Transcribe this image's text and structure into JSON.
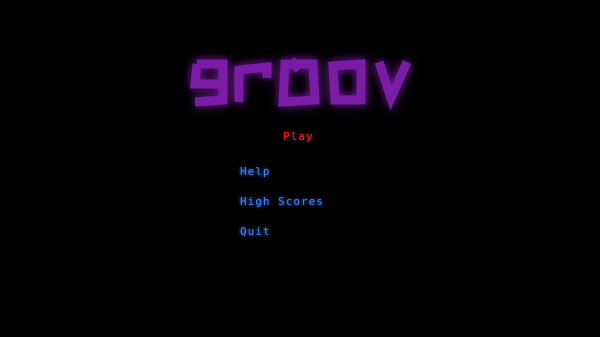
{
  "game": {
    "logo_text": "groov",
    "logo_color": "#7a1fa6",
    "logo_glow": "#9a33cc"
  },
  "menu": {
    "selected_color": "#e0222a",
    "item_color": "#3f82ff",
    "items": [
      {
        "id": "play",
        "label": "Play",
        "selected": true
      },
      {
        "id": "help",
        "label": "Help",
        "selected": false
      },
      {
        "id": "highscores",
        "label": "High Scores",
        "selected": false
      },
      {
        "id": "quit",
        "label": "Quit",
        "selected": false
      }
    ]
  }
}
